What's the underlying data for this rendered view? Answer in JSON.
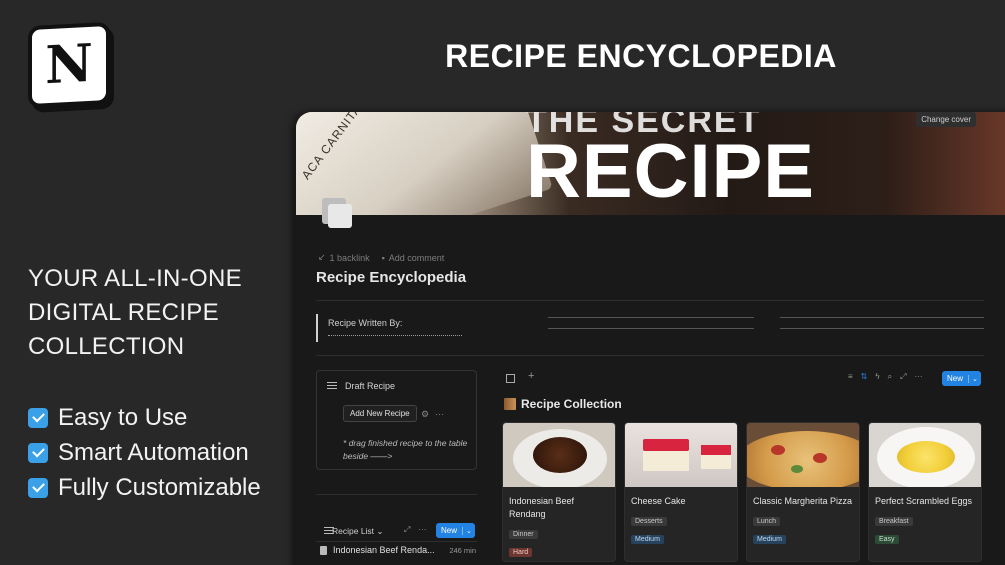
{
  "banner": {
    "title": "RECIPE ENCYCLOPEDIA",
    "tagline": "YOUR ALL-IN-ONE DIGITAL RECIPE COLLECTION",
    "features": [
      "Easy to Use",
      "Smart Automation",
      "Fully Customizable"
    ]
  },
  "logo": {
    "letter": "N"
  },
  "cover": {
    "top_text": "THE SECRET",
    "big_text": "RECIPE",
    "book_text": "ACA CARNITAS",
    "change_cover": "Change cover"
  },
  "page": {
    "backlink": "1 backlink",
    "comment": "Add comment",
    "title": "Recipe Encyclopedia",
    "callout_label": "Recipe Written By:"
  },
  "draft": {
    "label": "Draft Recipe",
    "button": "Add New Recipe",
    "note": "* drag finished recipe to the table beside ——>"
  },
  "recipe_list": {
    "label": "Recipe List",
    "new_button": "New",
    "row_name": "Indonesian Beef Renda...",
    "row_duration": "246 min"
  },
  "gallery": {
    "title": "Recipe Collection",
    "new_button": "New",
    "cards": [
      {
        "name": "Indonesian Beef Rendang",
        "category": "Dinner",
        "difficulty": "Hard"
      },
      {
        "name": "Cheese Cake",
        "category": "Desserts",
        "difficulty": "Medium"
      },
      {
        "name": "Classic Margherita Pizza",
        "category": "Lunch",
        "difficulty": "Medium"
      },
      {
        "name": "Perfect Scrambled Eggs",
        "category": "Breakfast",
        "difficulty": "Easy"
      }
    ]
  },
  "colors": {
    "background": "#282828",
    "accent": "#2383e2",
    "check": "#3aa0e8"
  }
}
